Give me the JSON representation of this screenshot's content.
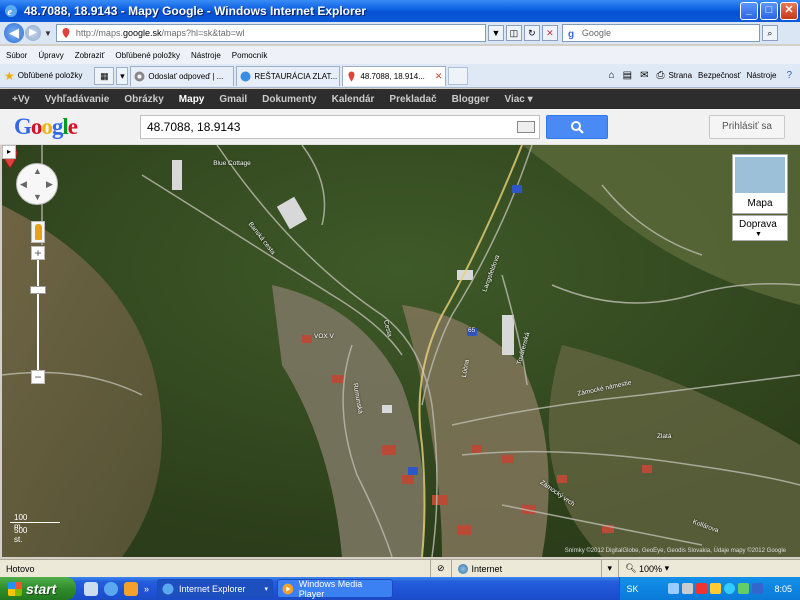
{
  "window": {
    "title": "48.7088, 18.9143 - Mapy Google - Windows Internet Explorer",
    "buttons": {
      "minimize": "_",
      "maximize": "□",
      "close": "✕"
    }
  },
  "address_bar": {
    "url_prefix": "http://maps.",
    "url_domain": "google.sk",
    "url_suffix": "/maps?hl=sk&tab=wl",
    "search_placeholder": "Google"
  },
  "menu": [
    "Súbor",
    "Úpravy",
    "Zobraziť",
    "Obľúbené položky",
    "Nástroje",
    "Pomocník"
  ],
  "favorites": {
    "label": "Obľúbené položky",
    "tabs": [
      {
        "label": "Odoslať odpoveď | ...",
        "active": false
      },
      {
        "label": "REŠTAURÁCIA ZLAT...",
        "active": false
      },
      {
        "label": "48.7088, 18.914...",
        "active": true
      }
    ]
  },
  "command_bar": {
    "page": "Strana",
    "safety": "Bezpečnosť",
    "tools": "Nástroje"
  },
  "google_bar": [
    "+Vy",
    "Vyhľadávanie",
    "Obrázky",
    "Mapy",
    "Gmail",
    "Dokumenty",
    "Kalendár",
    "Prekladač",
    "Blogger",
    "Viac ▾"
  ],
  "google_bar_active": "Mapy",
  "google": {
    "logo": "Google",
    "search_value": "48.7088, 18.9143",
    "search_button_icon": "magnifier-icon",
    "signin": "Prihlásiť sa"
  },
  "map": {
    "controls": {
      "maptype_label": "Mapa",
      "traffic_label": "Doprava",
      "zoom_in": "+",
      "zoom_out": "−"
    },
    "scale": {
      "metric": "100 m",
      "imperial": "500 st."
    },
    "labels": [
      {
        "text": "Blue Cottage"
      },
      {
        "text": "Banská cesta"
      },
      {
        "text": "VOX V"
      },
      {
        "text": "Langsfeldova"
      },
      {
        "text": "Továrenská"
      },
      {
        "text": "Zámocké námestie"
      },
      {
        "text": "Zlatá"
      },
      {
        "text": "Zámocký vrch"
      },
      {
        "text": "Kollárova"
      },
      {
        "text": "Rumunská"
      },
      {
        "text": "Cesta"
      },
      {
        "text": "65"
      },
      {
        "text": "Lúčna"
      }
    ],
    "copyright": "Snímky ©2012 DigitalGlobe, GeoEye, Geodis Slovakia, Údaje mapy ©2012 Google"
  },
  "status": {
    "text": "Hotovo",
    "zone": "Internet",
    "zoom": "100%"
  },
  "taskbar": {
    "start": "start",
    "items": [
      {
        "label": "Internet Explorer",
        "active": true
      },
      {
        "label": "Windows Media Player",
        "active": false
      }
    ],
    "lang": "SK",
    "clock": "8:05"
  },
  "colors": {
    "ie_blue": "#0a5ee0",
    "google_blue": "#4a8af4",
    "start_green": "#2f8d2b",
    "map_marker": "#e0413b"
  }
}
